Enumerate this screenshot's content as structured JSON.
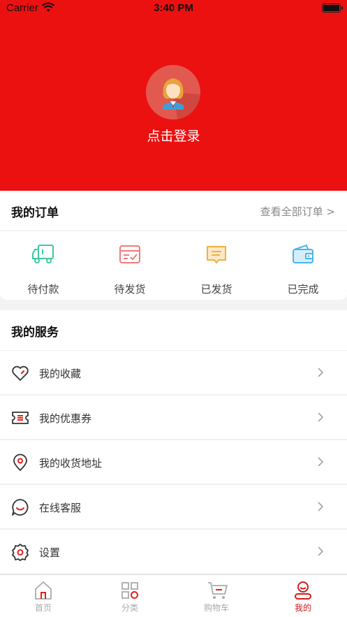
{
  "status_bar": {
    "carrier": "Carrier",
    "time": "3:40 PM"
  },
  "profile": {
    "login_label": "点击登录"
  },
  "orders": {
    "title": "我的订单",
    "view_all": "查看全部订单 >",
    "items": [
      {
        "label": "待付款",
        "icon": "truck-icon"
      },
      {
        "label": "待发货",
        "icon": "package-check-icon"
      },
      {
        "label": "已发货",
        "icon": "message-box-icon"
      },
      {
        "label": "已完成",
        "icon": "wallet-icon"
      }
    ]
  },
  "services": {
    "title": "我的服务",
    "items": [
      {
        "label": "我的收藏",
        "icon": "heart-icon"
      },
      {
        "label": "我的优惠券",
        "icon": "coupon-icon"
      },
      {
        "label": "我的收货地址",
        "icon": "location-pin-icon"
      },
      {
        "label": "在线客服",
        "icon": "chat-icon"
      },
      {
        "label": "设置",
        "icon": "gear-icon"
      }
    ]
  },
  "tabbar": {
    "items": [
      {
        "label": "首页",
        "icon": "home-icon"
      },
      {
        "label": "分类",
        "icon": "grid-icon"
      },
      {
        "label": "购物车",
        "icon": "cart-icon"
      },
      {
        "label": "我的",
        "icon": "user-icon"
      }
    ],
    "active_color": "#d61a1a"
  },
  "colors": {
    "brand": "#eb1111"
  }
}
